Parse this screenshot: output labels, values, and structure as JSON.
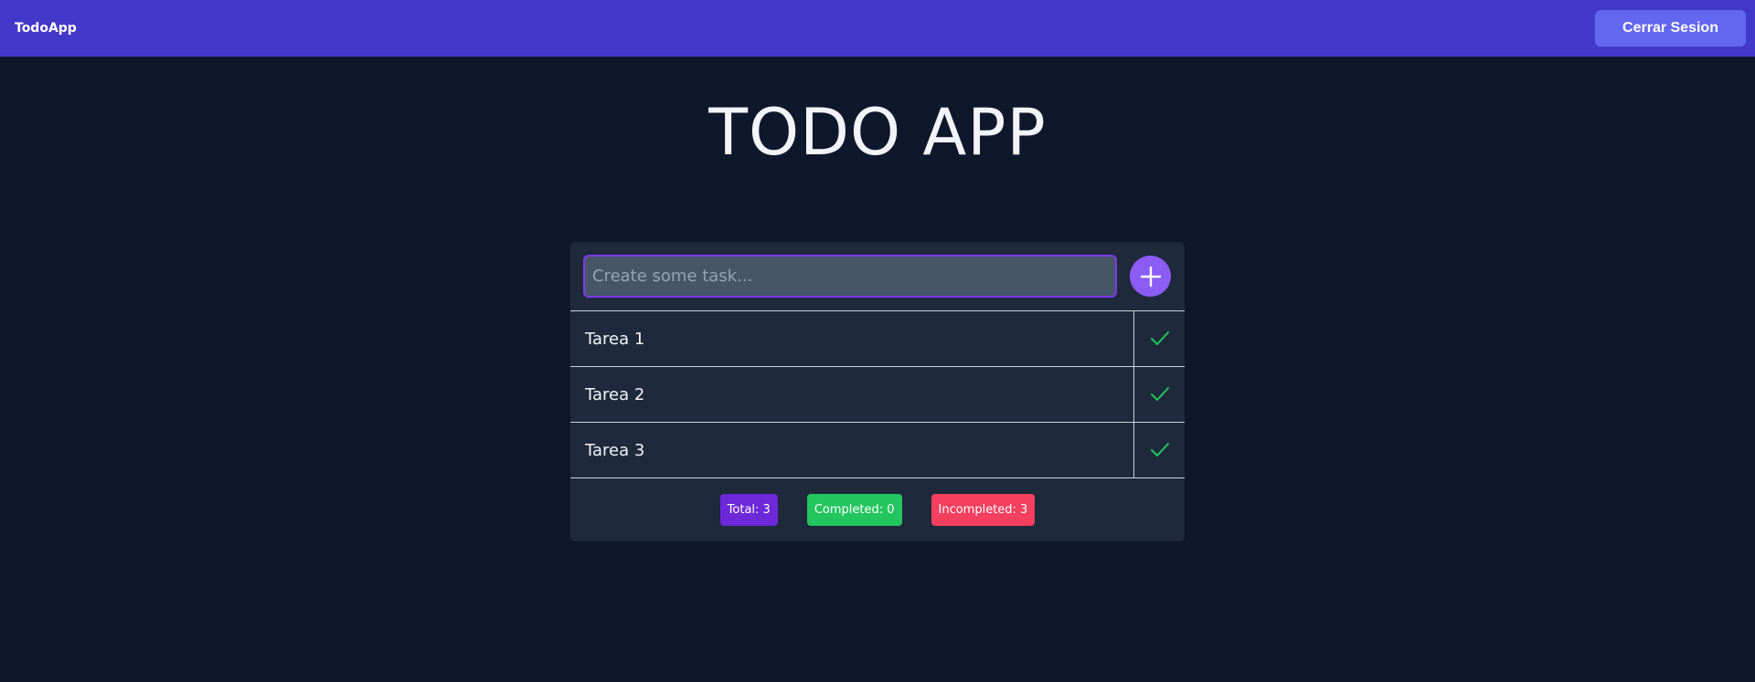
{
  "navbar": {
    "brand": "TodoApp",
    "logout_label": "Cerrar Sesion"
  },
  "page": {
    "title": "TODO APP"
  },
  "form": {
    "placeholder": "Create some task...",
    "value": "",
    "add_icon": "plus-icon"
  },
  "tasks": [
    {
      "label": "Tarea 1",
      "status_icon": "check-icon",
      "completed": false
    },
    {
      "label": "Tarea 2",
      "status_icon": "check-icon",
      "completed": false
    },
    {
      "label": "Tarea 3",
      "status_icon": "check-icon",
      "completed": false
    }
  ],
  "stats": {
    "total_label": "Total: 3",
    "completed_label": "Completed: 0",
    "incompleted_label": "Incompleted: 3"
  },
  "colors": {
    "navbar": "#4338ca",
    "logout_button": "#6366f1",
    "background": "#0f172a",
    "card": "#1e293b",
    "accent": "#8b5cf6",
    "check": "#22c55e",
    "badge_total": "#6d28d9",
    "badge_completed": "#22c55e",
    "badge_incompleted": "#f43f5e"
  }
}
